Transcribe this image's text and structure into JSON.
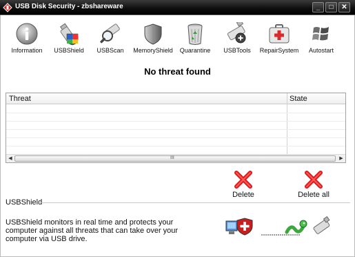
{
  "window": {
    "title": "USB Disk Security - zbshareware",
    "minimize": "_",
    "maximize": "□",
    "close": "✕"
  },
  "toolbar": {
    "items": [
      {
        "label": "Information",
        "icon": "info-icon"
      },
      {
        "label": "USBShield",
        "icon": "usb-shield-icon"
      },
      {
        "label": "USBScan",
        "icon": "usb-scan-icon"
      },
      {
        "label": "MemoryShield",
        "icon": "memory-shield-icon"
      },
      {
        "label": "Quarantine",
        "icon": "recycle-bin-icon"
      },
      {
        "label": "USBTools",
        "icon": "usb-tools-icon"
      },
      {
        "label": "RepairSystem",
        "icon": "first-aid-kit-icon"
      },
      {
        "label": "Autostart",
        "icon": "windows-flag-icon"
      }
    ]
  },
  "status": "No threat found",
  "table": {
    "columns": [
      "Threat",
      "State"
    ],
    "rows": [],
    "scroll_grip": "III"
  },
  "actions": {
    "delete": "Delete",
    "delete_all": "Delete all"
  },
  "shield_panel": {
    "title": "USBShield",
    "description": "USBShield monitors in real time and protects your computer against all threats that can take over your computer via USB drive."
  },
  "colors": {
    "titlebar": "#000000",
    "delete_red": "#e01a1a",
    "background": "#ffffff"
  }
}
